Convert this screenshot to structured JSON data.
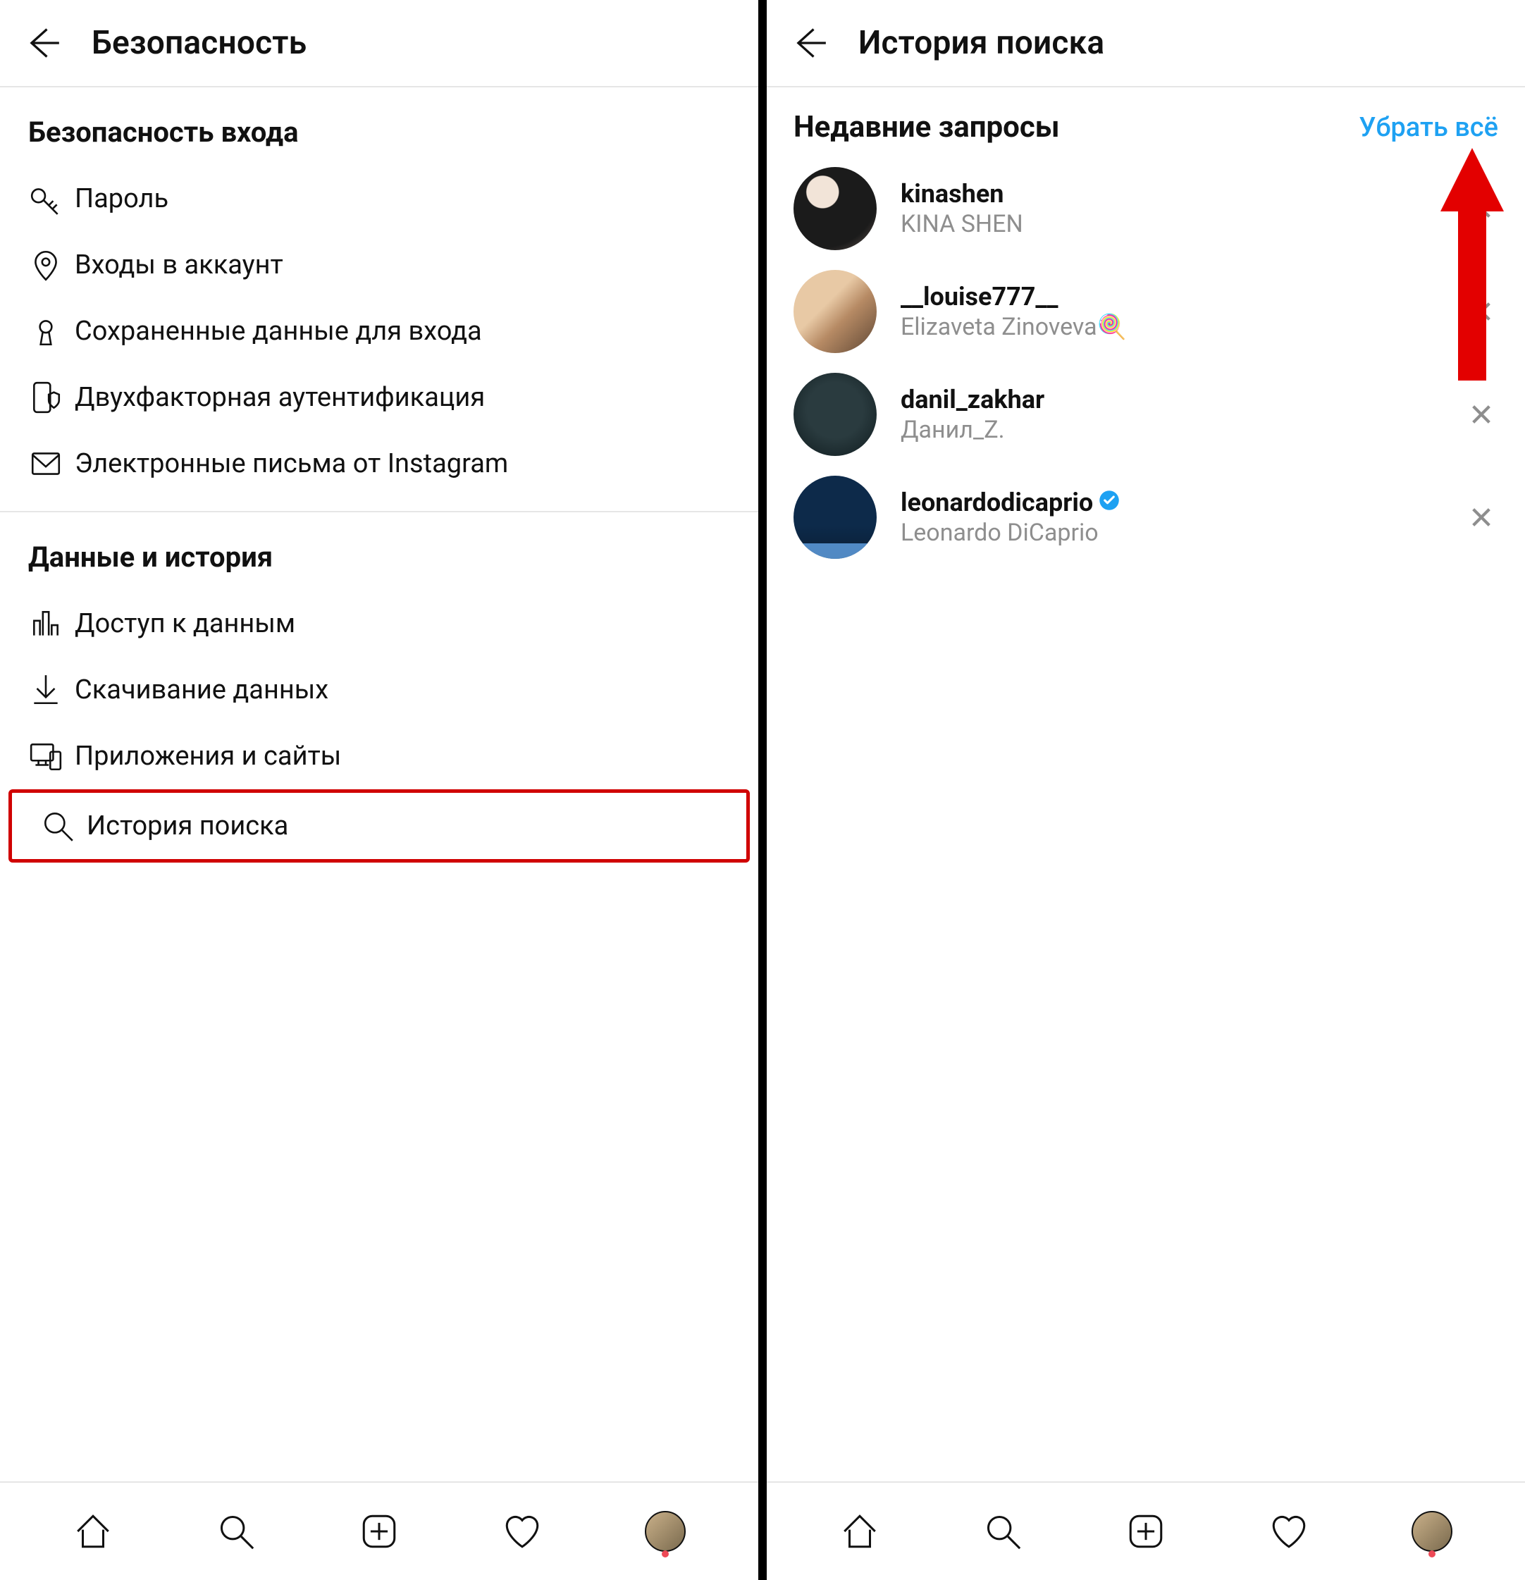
{
  "left": {
    "title": "Безопасность",
    "sections": [
      {
        "header": "Безопасность входа",
        "items": [
          {
            "icon": "key",
            "label": "Пароль"
          },
          {
            "icon": "pin",
            "label": "Входы в аккаунт"
          },
          {
            "icon": "keyhole",
            "label": "Сохраненные данные для входа"
          },
          {
            "icon": "phone-shield",
            "label": "Двухфакторная аутентификация"
          },
          {
            "icon": "mail",
            "label": "Электронные письма от Instagram"
          }
        ]
      },
      {
        "header": "Данные и история",
        "items": [
          {
            "icon": "bars",
            "label": "Доступ к данным"
          },
          {
            "icon": "download",
            "label": "Скачивание данных"
          },
          {
            "icon": "devices",
            "label": "Приложения и сайты"
          },
          {
            "icon": "search",
            "label": "История поиска",
            "highlighted": true
          }
        ]
      }
    ]
  },
  "right": {
    "title": "История поиска",
    "recent_header": "Недавние запросы",
    "clear_all": "Убрать всё",
    "items": [
      {
        "username": "kinashen",
        "fullname": "KINA SHEN",
        "verified": false,
        "emoji": "",
        "avatar": "av1"
      },
      {
        "username": "__louise777__",
        "fullname": "Elizaveta Zinoveva",
        "verified": false,
        "emoji": "🍭",
        "avatar": "av2"
      },
      {
        "username": "danil_zakhar",
        "fullname": "Данил_Z.",
        "verified": false,
        "emoji": "",
        "avatar": "av3"
      },
      {
        "username": "leonardodicaprio",
        "fullname": "Leonardo DiCaprio",
        "verified": true,
        "emoji": "",
        "avatar": "av4"
      }
    ]
  },
  "nav": [
    "home",
    "search",
    "add",
    "heart",
    "profile"
  ]
}
